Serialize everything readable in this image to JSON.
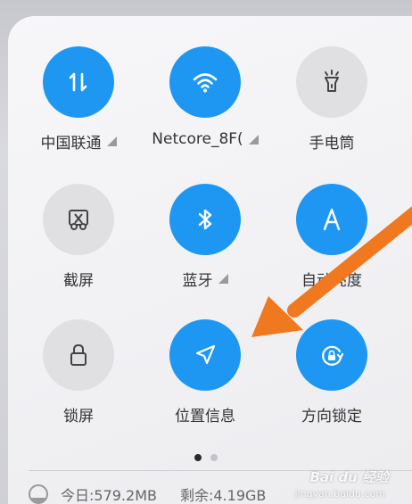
{
  "tiles": [
    {
      "label": "中国联通",
      "icon": "mobile-data-icon",
      "active": true,
      "has_menu": true
    },
    {
      "label": "Netcore_8F(",
      "icon": "wifi-icon",
      "active": true,
      "has_menu": true
    },
    {
      "label": "手电筒",
      "icon": "flashlight-icon",
      "active": false,
      "has_menu": false
    },
    {
      "label": "截屏",
      "icon": "screenshot-icon",
      "active": false,
      "has_menu": false
    },
    {
      "label": "蓝牙",
      "icon": "bluetooth-icon",
      "active": true,
      "has_menu": true
    },
    {
      "label": "自动亮度",
      "icon": "auto-brightness-icon",
      "active": true,
      "has_menu": false
    },
    {
      "label": "锁屏",
      "icon": "lock-icon",
      "active": false,
      "has_menu": false
    },
    {
      "label": "位置信息",
      "icon": "location-icon",
      "active": true,
      "has_menu": false
    },
    {
      "label": "方向锁定",
      "icon": "rotation-lock-icon",
      "active": true,
      "has_menu": false
    }
  ],
  "pager": {
    "pages": 2,
    "current": 1
  },
  "usage": {
    "today": "今日:579.2MB",
    "remaining": "剩余:4.19GB",
    "used_fraction": 0.3
  },
  "watermark": {
    "text": "Bai du 经验",
    "sub": "jingyan.baidu.com"
  },
  "colors": {
    "active": "#1e97f3",
    "inactive": "#e0e0e3",
    "arrow": "#f0781f",
    "label": "#333333"
  }
}
